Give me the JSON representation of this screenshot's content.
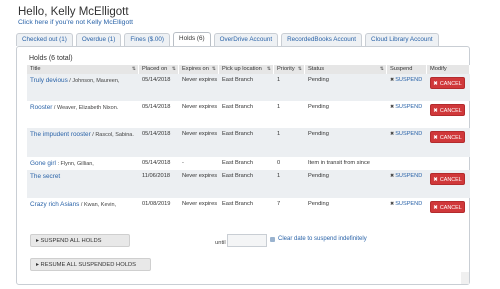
{
  "header": {
    "greeting": "Hello, Kelly McElligott",
    "not_me_link": "Click here if you're not Kelly McElligott"
  },
  "tabs": [
    {
      "label": "Checked out (1)",
      "active": false
    },
    {
      "label": "Overdue (1)",
      "active": false
    },
    {
      "label": "Fines ($.00)",
      "active": false
    },
    {
      "label": "Holds (6)",
      "active": true
    },
    {
      "label": "OverDrive Account",
      "active": false
    },
    {
      "label": "RecordedBooks Account",
      "active": false
    },
    {
      "label": "Cloud Library Account",
      "active": false
    }
  ],
  "holds": {
    "title": "Holds (6 total)",
    "columns": [
      "Title",
      "Placed on",
      "Expires on",
      "Pick up location",
      "Priority",
      "Status",
      "Suspend",
      "Modify"
    ],
    "rows": [
      {
        "title": "Truly devious",
        "author": " / Johnson, Maureen,",
        "placed": "05/14/2018",
        "expires": "Never expires",
        "location": "East Branch",
        "priority": "1",
        "status": "Pending",
        "suspend": "SUSPEND",
        "cancel": "CANCEL"
      },
      {
        "title": "Rooster",
        "author": " / Weaver, Elizabeth Nixon.",
        "placed": "05/14/2018",
        "expires": "Never expires",
        "location": "East Branch",
        "priority": "1",
        "status": "Pending",
        "suspend": "SUSPEND",
        "cancel": "CANCEL"
      },
      {
        "title": "The impudent rooster",
        "author": " / Rascol, Sabina.",
        "placed": "05/14/2018",
        "expires": "Never expires",
        "location": "East Branch",
        "priority": "1",
        "status": "Pending",
        "suspend": "SUSPEND",
        "cancel": "CANCEL"
      },
      {
        "title": "Gone girl",
        "author": " : Flynn, Gillian,",
        "placed": "05/14/2018",
        "expires": "-",
        "location": "East Branch",
        "priority": "0",
        "status": "Item in transit from since",
        "suspend": "",
        "cancel": ""
      },
      {
        "title": "The secret",
        "author": "",
        "placed": "11/06/2018",
        "expires": "Never expires",
        "location": "East Branch",
        "priority": "1",
        "status": "Pending",
        "suspend": "SUSPEND",
        "cancel": "CANCEL"
      },
      {
        "title": "Crazy rich Asians",
        "author": " / Kwan, Kevin,",
        "placed": "01/08/2019",
        "expires": "Never expires",
        "location": "East Branch",
        "priority": "7",
        "status": "Pending",
        "suspend": "SUSPEND",
        "cancel": "CANCEL"
      }
    ]
  },
  "actions": {
    "suspend_all": "SUSPEND ALL HOLDS",
    "until_label": "until",
    "date_value": "",
    "clear_date_link": "Clear date to suspend indefinitely",
    "resume_all": "RESUME ALL SUSPENDED HOLDS"
  },
  "colors": {
    "link": "#2a63a8",
    "cancel_button": "#d0383a",
    "shaded_row": "#eceff2",
    "header_row": "#e6e6e6"
  }
}
